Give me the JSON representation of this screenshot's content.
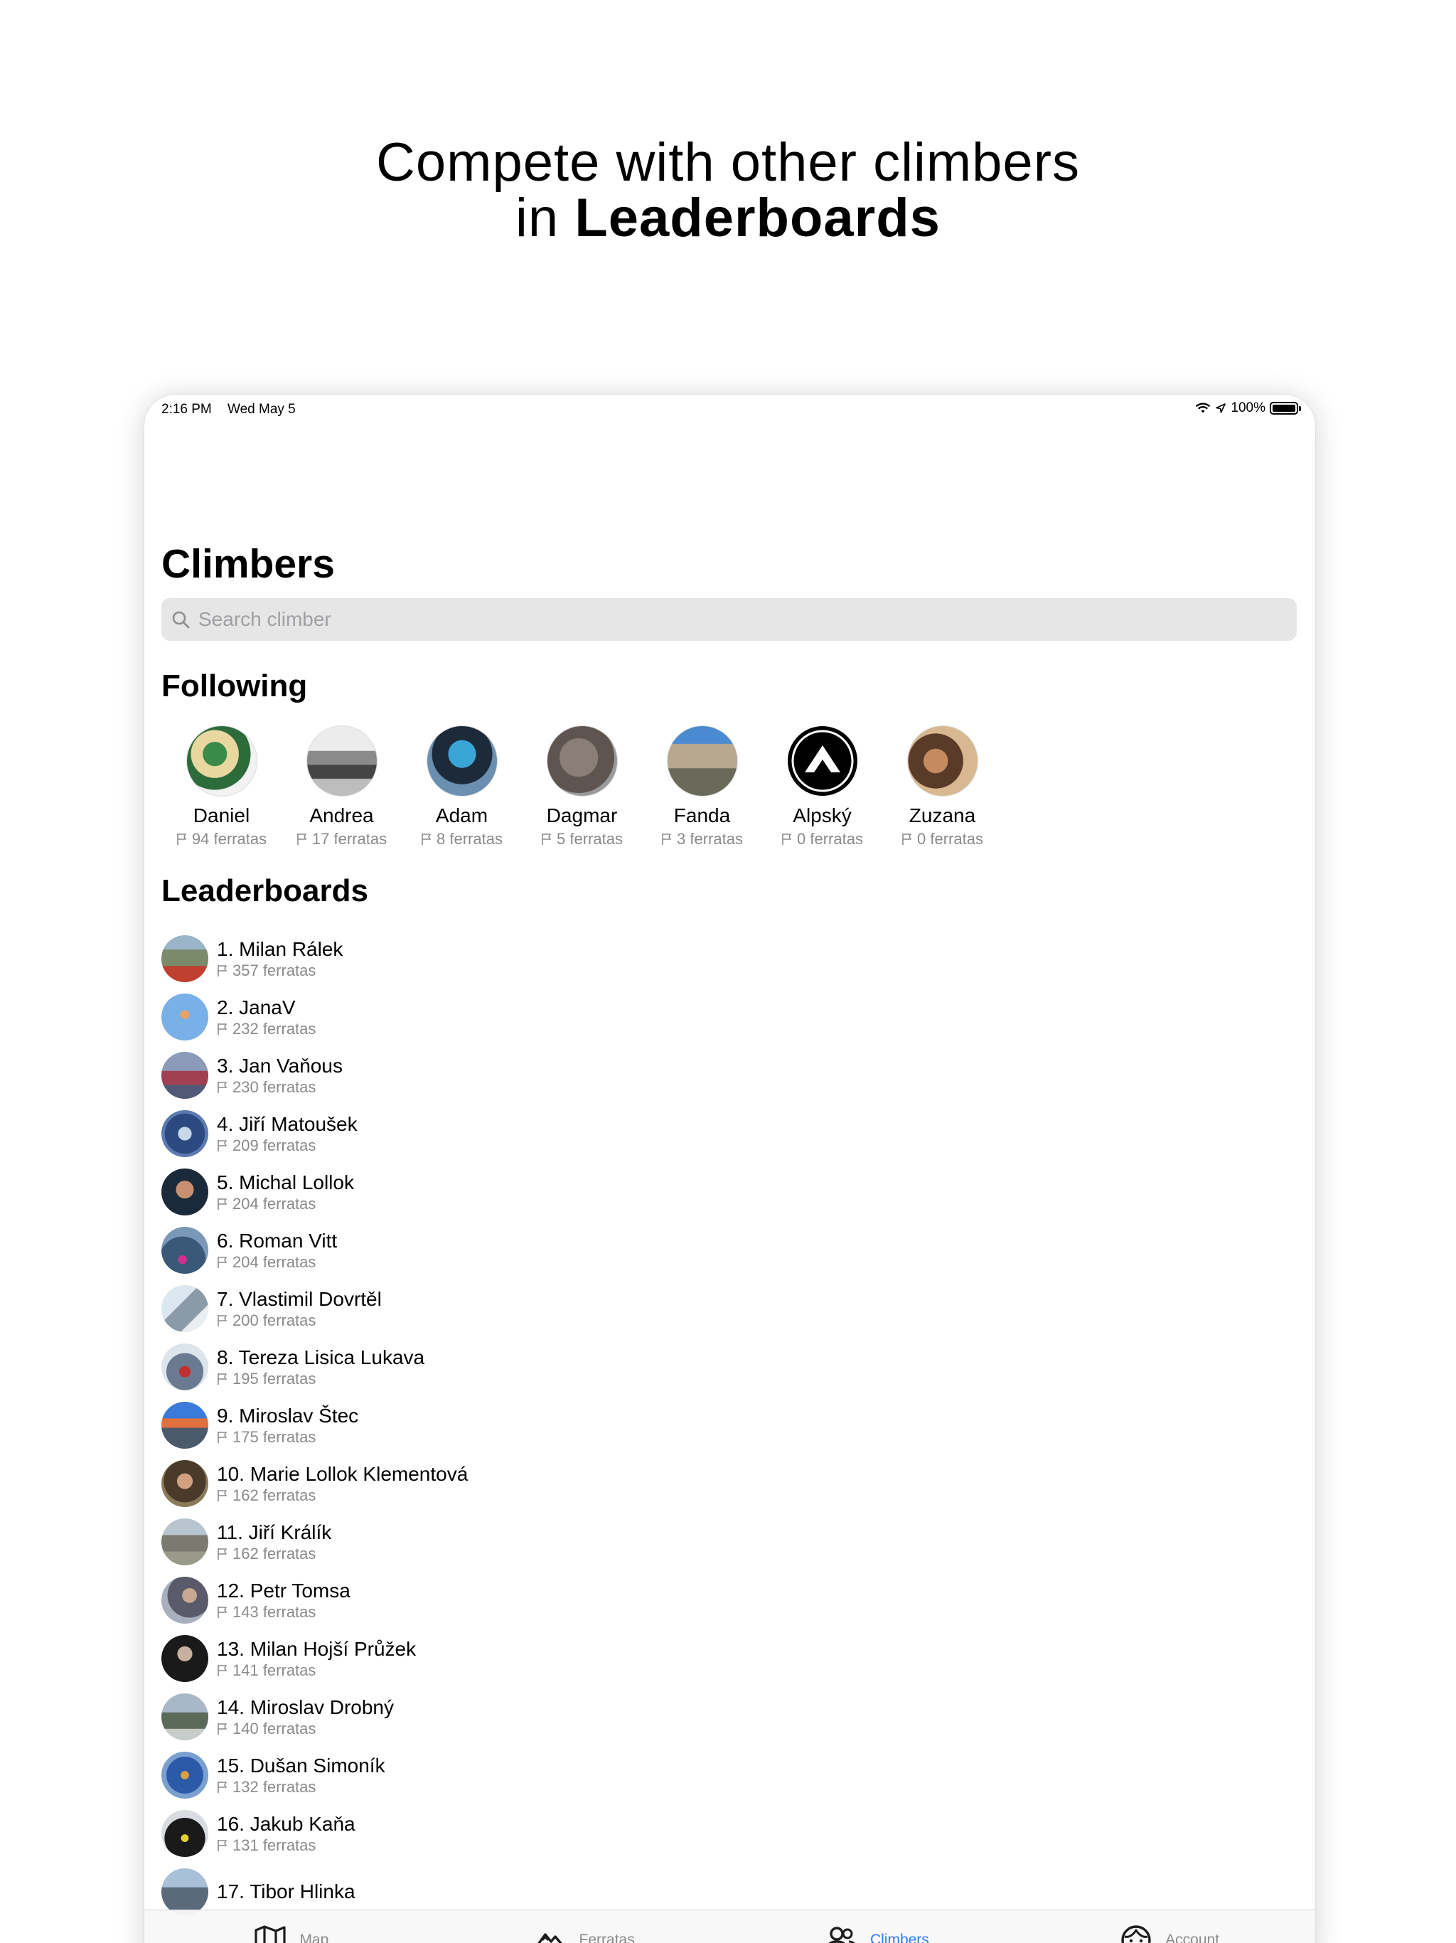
{
  "headline": {
    "line1": "Compete with other climbers",
    "line2_prefix": "in ",
    "line2_bold": "Leaderboards"
  },
  "status_bar": {
    "time": "2:16 PM",
    "date": "Wed May 5",
    "battery": "100%",
    "icons": [
      "wifi-icon",
      "location-icon",
      "battery-icon"
    ]
  },
  "page": {
    "title": "Climbers",
    "search_placeholder": "Search climber"
  },
  "following": {
    "title": "Following",
    "items": [
      {
        "name": "Daniel",
        "count": "94 ferratas"
      },
      {
        "name": "Andrea",
        "count": "17 ferratas"
      },
      {
        "name": "Adam",
        "count": "8 ferratas"
      },
      {
        "name": "Dagmar",
        "count": "5 ferratas"
      },
      {
        "name": "Fanda",
        "count": "3 ferratas"
      },
      {
        "name": "Alpský",
        "count": "0 ferratas"
      },
      {
        "name": "Zuzana",
        "count": "0 ferratas"
      }
    ]
  },
  "leaderboards": {
    "title": "Leaderboards",
    "rows": [
      {
        "name": "1. Milan Rálek",
        "count": "357 ferratas"
      },
      {
        "name": "2. JanaV",
        "count": "232 ferratas"
      },
      {
        "name": "3. Jan Vaňous",
        "count": "230 ferratas"
      },
      {
        "name": "4. Jiří Matoušek",
        "count": "209 ferratas"
      },
      {
        "name": "5. Michal Lollok",
        "count": "204 ferratas"
      },
      {
        "name": "6. Roman Vitt",
        "count": "204 ferratas"
      },
      {
        "name": "7. Vlastimil Dovrtěl",
        "count": "200 ferratas"
      },
      {
        "name": "8. Tereza Lisica Lukava",
        "count": "195 ferratas"
      },
      {
        "name": "9. Miroslav Štec",
        "count": "175 ferratas"
      },
      {
        "name": "10. Marie Lollok Klementová",
        "count": "162 ferratas"
      },
      {
        "name": "11. Jiří Králík",
        "count": "162 ferratas"
      },
      {
        "name": "12. Petr Tomsa",
        "count": "143 ferratas"
      },
      {
        "name": "13. Milan Hojší Průžek",
        "count": "141 ferratas"
      },
      {
        "name": "14. Miroslav Drobný",
        "count": "140 ferratas"
      },
      {
        "name": "15. Dušan Simoník",
        "count": "132 ferratas"
      },
      {
        "name": "16. Jakub Kaňa",
        "count": "131 ferratas"
      },
      {
        "name": "17. Tibor Hlinka",
        "count": ""
      }
    ]
  },
  "tab_bar": {
    "tabs": [
      {
        "label": "Map",
        "icon": "map-icon"
      },
      {
        "label": "Ferratas",
        "icon": "mountain-icon"
      },
      {
        "label": "Climbers",
        "icon": "people-icon",
        "active": true
      },
      {
        "label": "Account",
        "icon": "face-icon"
      }
    ],
    "active_color": "#2f7cf6",
    "inactive_color": "#8a8a8e"
  }
}
